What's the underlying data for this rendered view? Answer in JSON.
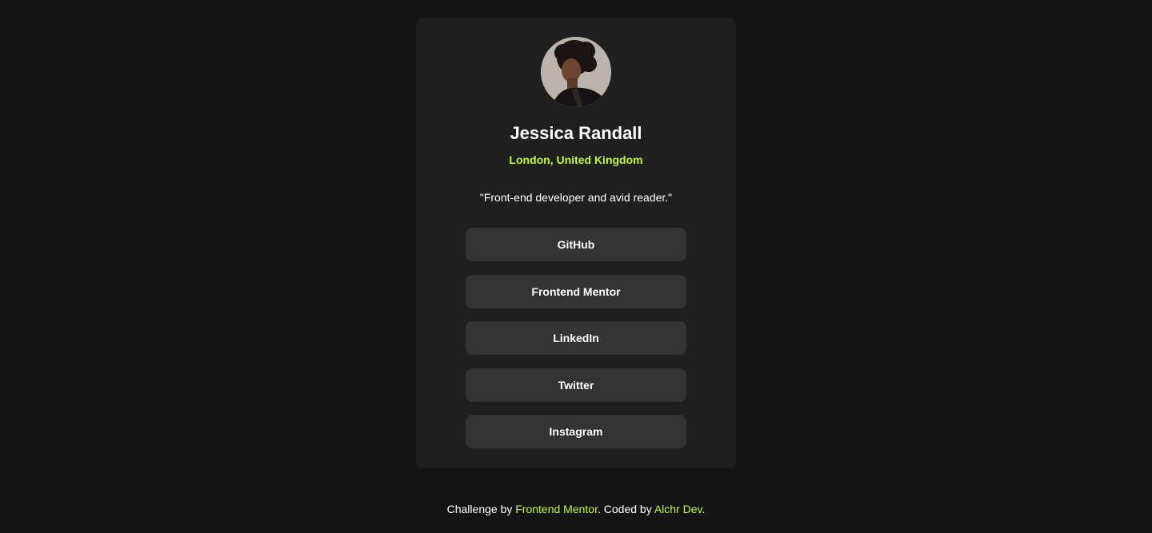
{
  "colors": {
    "page_background": "#141414",
    "card_background": "#1f1f1f",
    "button_background": "#333333",
    "accent": "#c4f82a",
    "text": "#ffffff"
  },
  "profile": {
    "avatar_icon": "profile-photo",
    "name": "Jessica Randall",
    "location": "London, United Kingdom",
    "bio": "\"Front-end developer and avid reader.\""
  },
  "links": [
    {
      "label": "GitHub"
    },
    {
      "label": "Frontend Mentor"
    },
    {
      "label": "LinkedIn"
    },
    {
      "label": "Twitter"
    },
    {
      "label": "Instagram"
    }
  ],
  "footer": {
    "prefix": "Challenge by ",
    "challenge_link": "Frontend Mentor",
    "middle": ". Coded by ",
    "author_link": "Alchr Dev",
    "suffix": "."
  }
}
